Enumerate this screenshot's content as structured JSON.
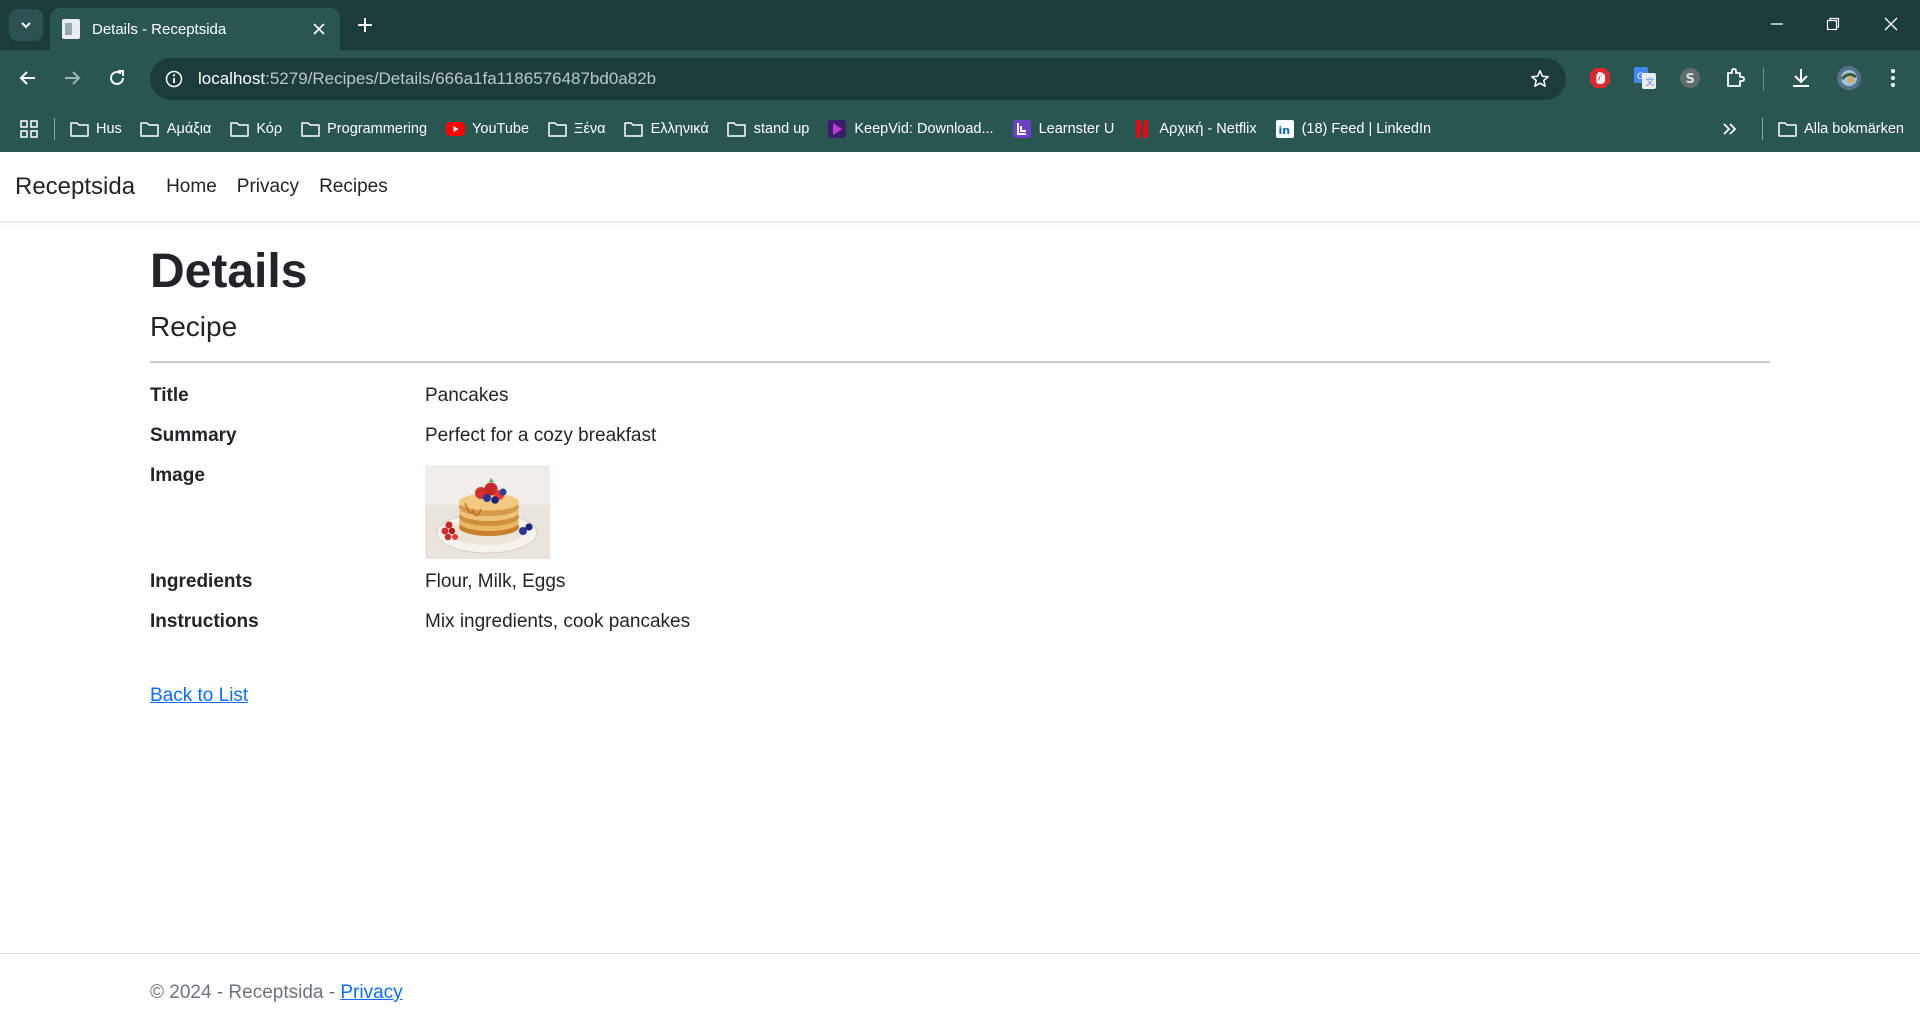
{
  "browser": {
    "tab_title": "Details - Receptsida",
    "url_host": "localhost",
    "url_path": ":5279/Recipes/Details/666a1fa1186576487bd0a82b",
    "bookmarks": [
      {
        "label": "Hus",
        "icon": "folder-icon"
      },
      {
        "label": "Αμάξια",
        "icon": "folder-icon"
      },
      {
        "label": "Κόρ",
        "icon": "folder-icon"
      },
      {
        "label": "Programmering",
        "icon": "folder-icon"
      },
      {
        "label": "YouTube",
        "icon": "youtube-icon"
      },
      {
        "label": "Ξένα",
        "icon": "folder-icon"
      },
      {
        "label": "Ελληνικά",
        "icon": "folder-icon"
      },
      {
        "label": "stand up",
        "icon": "folder-icon"
      },
      {
        "label": "KeepVid: Download...",
        "icon": "keepvid-icon"
      },
      {
        "label": "Learnster U",
        "icon": "learnster-icon"
      },
      {
        "label": "Αρχική - Netflix",
        "icon": "netflix-icon"
      },
      {
        "label": "(18) Feed | LinkedIn",
        "icon": "linkedin-icon"
      }
    ],
    "all_bookmarks_label": "Alla bokmärken"
  },
  "site": {
    "brand": "Receptsida",
    "nav": [
      "Home",
      "Privacy",
      "Recipes"
    ]
  },
  "page": {
    "heading": "Details",
    "subheading": "Recipe",
    "fields": {
      "title_label": "Title",
      "title_value": "Pancakes",
      "summary_label": "Summary",
      "summary_value": "Perfect for a cozy breakfast",
      "image_label": "Image",
      "ingredients_label": "Ingredients",
      "ingredients_value": "Flour, Milk, Eggs",
      "instructions_label": "Instructions",
      "instructions_value": "Mix ingredients, cook pancakes"
    },
    "back_link": "Back to List"
  },
  "footer": {
    "text": "© 2024 - Receptsida - ",
    "privacy_link": "Privacy"
  },
  "colors": {
    "chrome_dark": "#1c3c3c",
    "chrome": "#2a5652",
    "link": "#0d6efd"
  }
}
